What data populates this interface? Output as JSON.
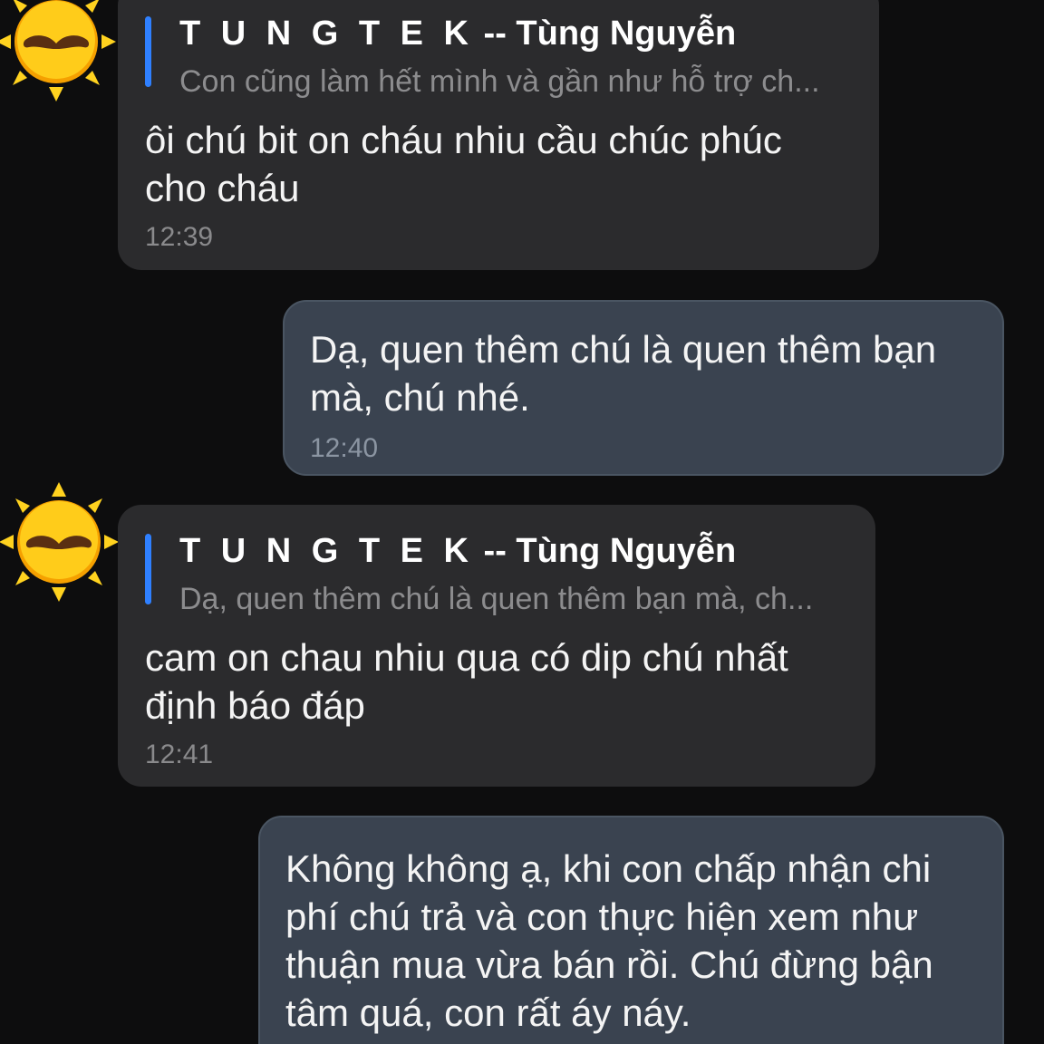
{
  "messages": [
    {
      "sender_prefix": "T U N G T E K",
      "sender_suffix": " -- Tùng Nguyễn",
      "quote_text": "Con cũng làm hết mình và gần như hỗ trợ ch...",
      "text": "ôi chú bit on cháu nhiu cầu chúc phúc cho cháu",
      "time": "12:39"
    },
    {
      "text": "Dạ, quen thêm chú là quen thêm bạn mà, chú nhé.",
      "time": "12:40"
    },
    {
      "sender_prefix": "T U N G T E K",
      "sender_suffix": " -- Tùng Nguyễn",
      "quote_text": "Dạ, quen thêm chú là quen thêm bạn mà, ch...",
      "text": "cam on chau nhiu qua có dip chú nhất định báo đáp",
      "time": "12:41"
    },
    {
      "text": "Không không ạ, khi con chấp nhận chi phí chú trả và con thực hiện xem như thuận mua vừa bán rồi. Chú đừng bận tâm quá, con rất áy náy."
    }
  ],
  "avatar": {
    "icon": "sun-mustache-avatar-icon",
    "colors": {
      "rays": "#ffd21f",
      "face": "#ffcc1a",
      "mustache": "#5a2f12"
    }
  },
  "colors": {
    "background": "#0d0d0e",
    "incoming_bubble": "#2b2b2d",
    "outgoing_bubble": "#3a4350",
    "quote_bar": "#2f80ff"
  }
}
